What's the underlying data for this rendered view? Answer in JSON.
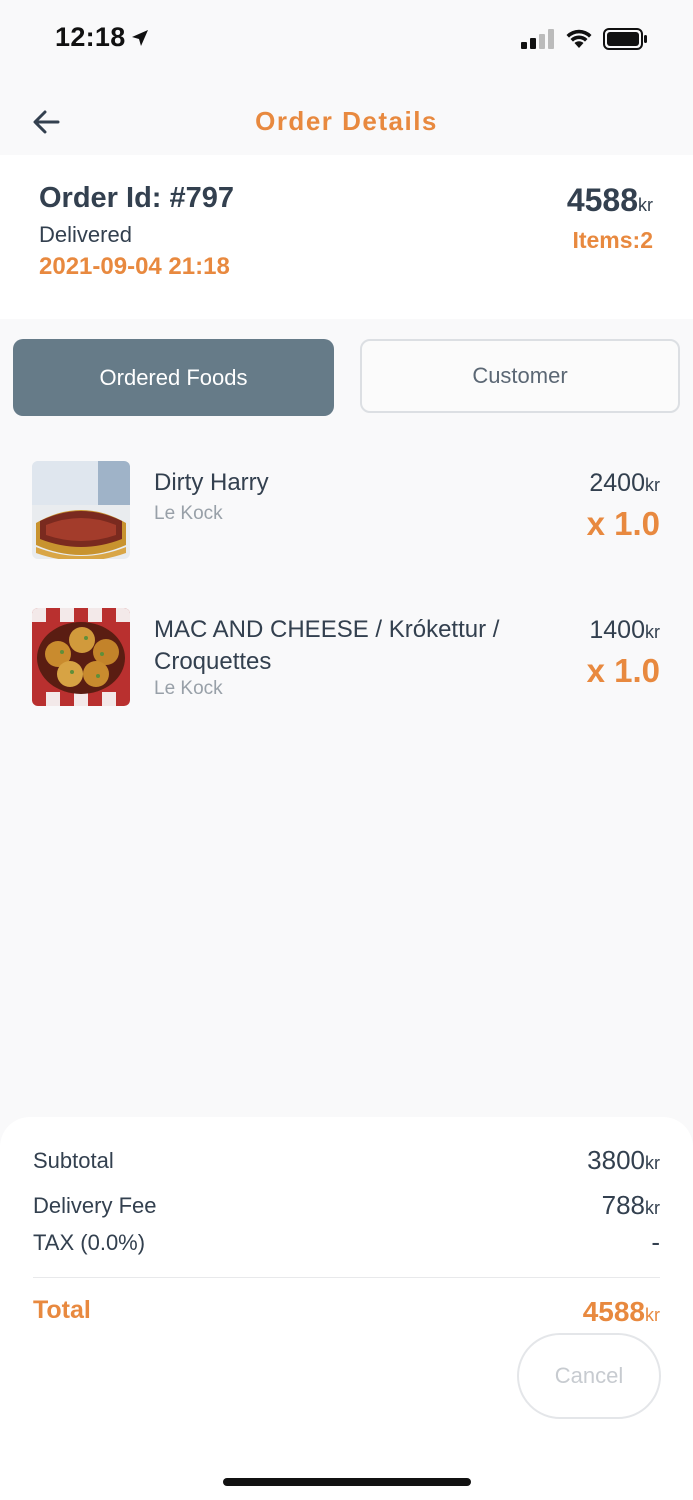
{
  "status_bar": {
    "time": "12:18"
  },
  "header": {
    "title": "Order Details"
  },
  "order": {
    "id_label": "Order Id: #797",
    "status": "Delivered",
    "date": "2021-09-04 21:18",
    "total": "4588",
    "currency": "kr",
    "items_label": "Items:2"
  },
  "tabs": [
    {
      "label": "Ordered Foods",
      "active": true
    },
    {
      "label": "Customer",
      "active": false
    }
  ],
  "foods": [
    {
      "name": "Dirty Harry",
      "vendor": "Le Kock",
      "price": "2400",
      "currency": "kr",
      "quantity": "x 1.0"
    },
    {
      "name": "MAC AND CHEESE / Krókettur / Croquettes",
      "vendor": "Le Kock",
      "price": "1400",
      "currency": "kr",
      "quantity": "x 1.0"
    }
  ],
  "summary": {
    "subtotal_label": "Subtotal",
    "subtotal_value": "3800",
    "delivery_label": "Delivery Fee",
    "delivery_value": "788",
    "tax_label": "TAX (0.0%)",
    "tax_value": "-",
    "total_label": "Total",
    "total_value": "4588",
    "currency": "kr",
    "cancel_label": "Cancel"
  },
  "colors": {
    "accent": "#e8893f",
    "text_dark": "#33404f",
    "tab_active": "#667b88"
  }
}
